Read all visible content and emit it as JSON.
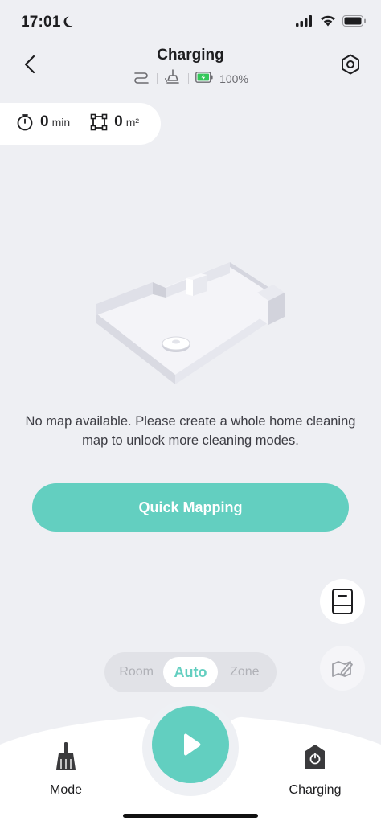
{
  "status_bar": {
    "time": "17:01"
  },
  "header": {
    "title": "Charging",
    "battery_text": "100%"
  },
  "stats": {
    "time_value": "0",
    "time_unit": "min",
    "area_value": "0",
    "area_unit": "m²"
  },
  "main": {
    "empty_message": "No map available. Please create a whole home cleaning map to unlock more cleaning modes.",
    "quick_mapping_label": "Quick Mapping"
  },
  "mode_switch": {
    "options": [
      "Room",
      "Auto",
      "Zone"
    ],
    "selected": "Auto"
  },
  "bottom_nav": {
    "mode_label": "Mode",
    "charging_label": "Charging"
  },
  "colors": {
    "accent": "#63cfc0",
    "background": "#eeeff3",
    "battery_green": "#34c759"
  }
}
